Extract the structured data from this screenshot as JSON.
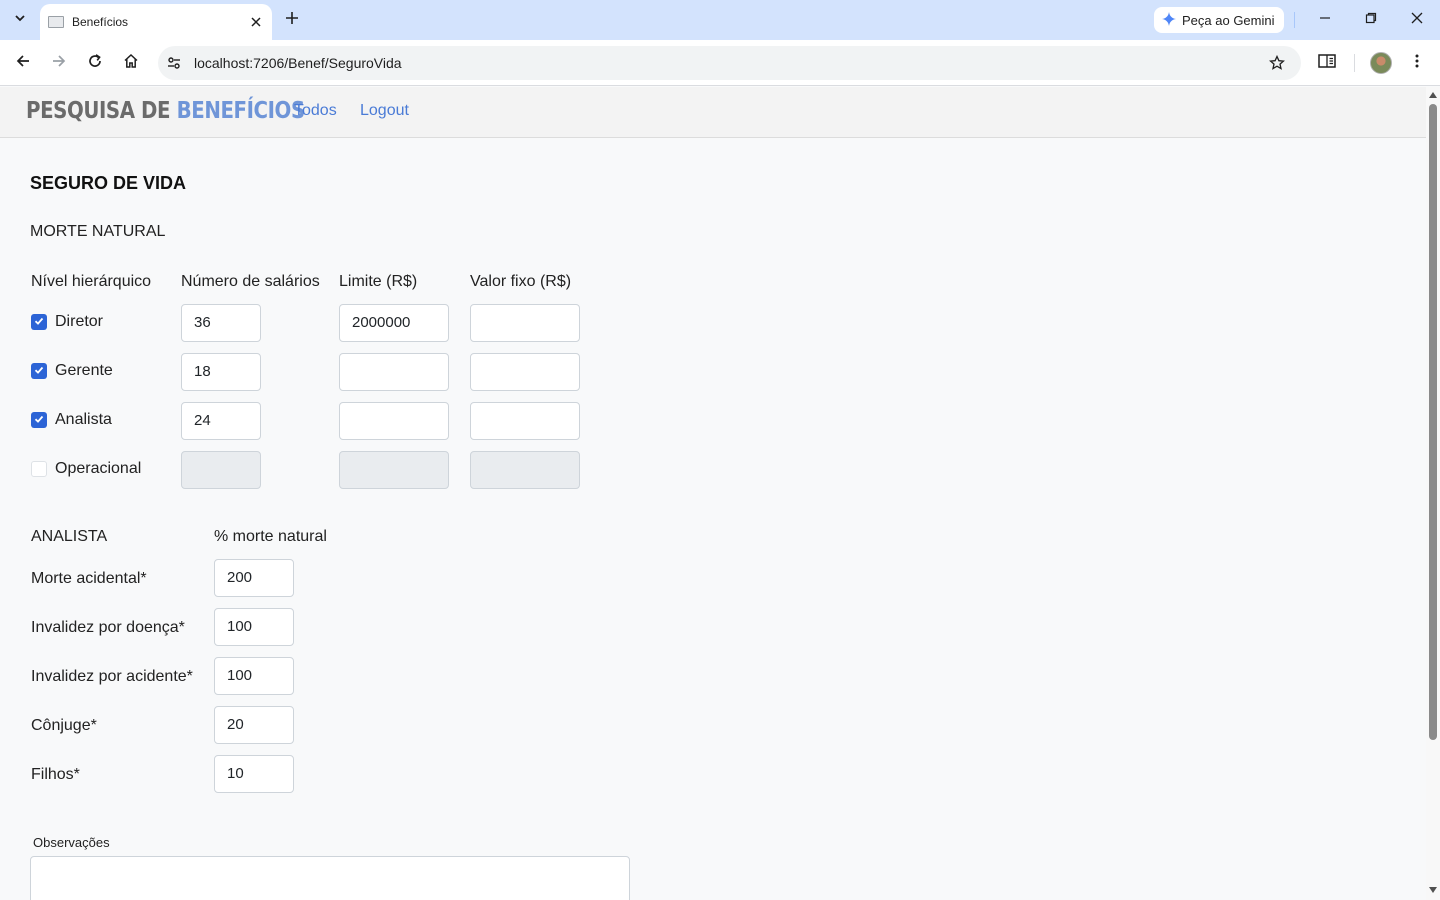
{
  "browser": {
    "tab_title": "Benefícios",
    "gemini_label": "Peça ao Gemini",
    "url": "localhost:7206/Benef/SeguroVida"
  },
  "navbar": {
    "brand_part1": "PESQUISA DE ",
    "brand_part2": "BENEFÍCIOS",
    "links": [
      "Todos",
      "Logout"
    ]
  },
  "page": {
    "title": "SEGURO DE VIDA",
    "section_morte_natural": "MORTE NATURAL",
    "columns": {
      "nivel": "Nível hierárquico",
      "salarios": "Número de salários",
      "limite": "Limite (R$)",
      "valor_fixo": "Valor fixo (R$)"
    },
    "levels": [
      {
        "label": "Diretor",
        "checked": true,
        "salarios": "36",
        "limite": "2000000",
        "valor_fixo": ""
      },
      {
        "label": "Gerente",
        "checked": true,
        "salarios": "18",
        "limite": "",
        "valor_fixo": ""
      },
      {
        "label": "Analista",
        "checked": true,
        "salarios": "24",
        "limite": "",
        "valor_fixo": ""
      },
      {
        "label": "Operacional",
        "checked": false,
        "salarios": "",
        "limite": "",
        "valor_fixo": ""
      }
    ],
    "analista_section": {
      "label": "ANALISTA",
      "col_head": "% morte natural",
      "rows": [
        {
          "label": "Morte acidental*",
          "value": "200"
        },
        {
          "label": "Invalidez por doença*",
          "value": "100"
        },
        {
          "label": "Invalidez por acidente*",
          "value": "100"
        },
        {
          "label": "Cônjuge*",
          "value": "20"
        },
        {
          "label": "Filhos*",
          "value": "10"
        }
      ]
    },
    "observacoes_label": "Observações",
    "observacoes_value": ""
  },
  "colors": {
    "accent": "#2c64d6",
    "link": "#4a7bd6",
    "brand_gray": "#6b6b6b",
    "brand_blue": "#6f95d8"
  }
}
